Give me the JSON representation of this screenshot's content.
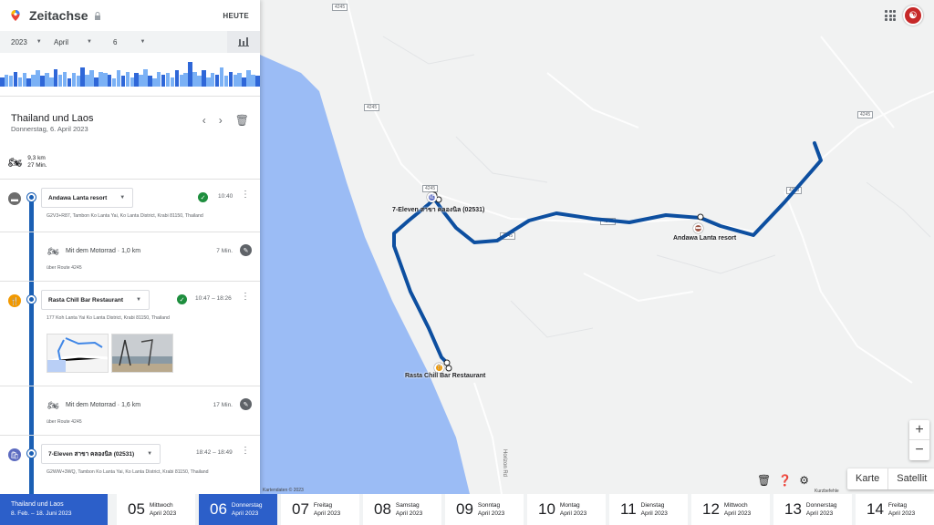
{
  "header": {
    "app_title": "Zeitachse",
    "today_label": "HEUTE"
  },
  "date_selector": {
    "year": "2023",
    "month": "April",
    "day": "6"
  },
  "histogram": {
    "values": [
      0.35,
      0.45,
      0.4,
      0.55,
      0.35,
      0.5,
      0.3,
      0.45,
      0.6,
      0.4,
      0.5,
      0.35,
      0.65,
      0.45,
      0.55,
      0.3,
      0.5,
      0.4,
      0.7,
      0.45,
      0.6,
      0.35,
      0.55,
      0.5,
      0.45,
      0.3,
      0.6,
      0.4,
      0.55,
      0.35,
      0.5,
      0.45,
      0.65,
      0.4,
      0.3,
      0.55,
      0.45,
      0.5,
      0.35,
      0.6,
      0.45,
      0.5,
      0.9,
      0.55,
      0.4,
      0.6,
      0.35,
      0.5,
      0.45,
      0.7,
      0.4,
      0.55,
      0.45,
      0.5,
      0.35,
      0.6,
      0.45,
      0.4
    ],
    "highlight_index": 42,
    "colors": {
      "bar": "#7bb1f5",
      "dark": "#2f67d8"
    }
  },
  "trip": {
    "title": "Thailand und Laos",
    "date": "Donnerstag, 6. April 2023",
    "distance": "9,3 km",
    "duration": "27 Min."
  },
  "places": [
    {
      "name": "Andawa Lanta resort",
      "time": "10:40",
      "address": "G2V3+R87, Tambon Ko Lanta Yai, Ko Lanta District, Krabi 81150, Thailand",
      "icon": "hotel-icon",
      "color": "#6d6d6d",
      "confirmed": true
    },
    {
      "name": "Rasta Chill Bar Restaurant",
      "time": "10:47 – 18:26",
      "address": "177 Koh Lanta Yai Ko Lanta District, Krabi 81150, Thailand",
      "icon": "restaurant-icon",
      "color": "#f29900",
      "confirmed": true
    },
    {
      "name": "7-Eleven สาขา คลองนิล (02531)",
      "time": "18:42 – 18:49",
      "address": "G2WW+3WQ, Tambon Ko Lanta Yai, Ko Lanta District, Krabi 81150, Thailand",
      "icon": "shopping-icon",
      "color": "#5c6bc0",
      "confirmed": false
    }
  ],
  "moves": [
    {
      "label": "Mit dem Motorrad · 1,0 km",
      "duration": "7 Min.",
      "route": "über Route 4245"
    },
    {
      "label": "Mit dem Motorrad · 1,6 km",
      "duration": "17 Min.",
      "route": "über Route 4245"
    }
  ],
  "map": {
    "labels": {
      "seven_eleven": "7-Eleven สาขา คลองนิล (02531)",
      "andawa": "Andawa Lanta resort",
      "rasta": "Rasta Chill Bar Restaurant"
    },
    "road_shields": [
      "4245",
      "4245",
      "4245",
      "4245",
      "4245",
      "4245",
      "4245"
    ],
    "road_name": "Horizon Rd",
    "credit": "Kartendaten © 2023",
    "shortcuts": "Kurzbefehle",
    "map_types": [
      "Karte",
      "Satellit"
    ],
    "route_color": "#0d4fa0",
    "sea_color": "#9bbcf5"
  },
  "bottom": {
    "trip_tab": {
      "title": "Thailand und Laos",
      "range": "8. Feb. – 18. Juni 2023"
    },
    "days": [
      {
        "num": "05",
        "weekday": "Mittwoch",
        "month": "April 2023",
        "selected": false
      },
      {
        "num": "06",
        "weekday": "Donnerstag",
        "month": "April 2023",
        "selected": true
      },
      {
        "num": "07",
        "weekday": "Freitag",
        "month": "April 2023",
        "selected": false
      },
      {
        "num": "08",
        "weekday": "Samstag",
        "month": "April 2023",
        "selected": false
      },
      {
        "num": "09",
        "weekday": "Sonntag",
        "month": "April 2023",
        "selected": false
      },
      {
        "num": "10",
        "weekday": "Montag",
        "month": "April 2023",
        "selected": false
      },
      {
        "num": "11",
        "weekday": "Dienstag",
        "month": "April 2023",
        "selected": false
      },
      {
        "num": "12",
        "weekday": "Mittwoch",
        "month": "April 2023",
        "selected": false
      },
      {
        "num": "13",
        "weekday": "Donnerstag",
        "month": "April 2023",
        "selected": false
      },
      {
        "num": "14",
        "weekday": "Freitag",
        "month": "April 2023",
        "selected": false
      }
    ]
  }
}
